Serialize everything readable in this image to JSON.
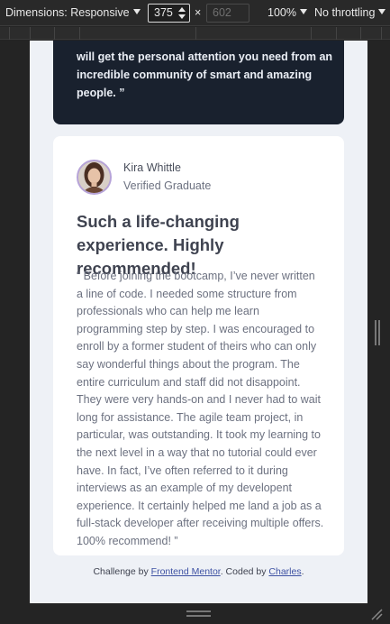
{
  "devtools": {
    "dimensions_label": "Dimensions: Responsive",
    "width_value": "375",
    "height_placeholder": "602",
    "times": "×",
    "zoom": "100%",
    "throttling": "No throttling"
  },
  "page": {
    "previous_card": {
      "text": "will get the personal attention you need from an incredible community of smart and amazing people. ”"
    },
    "testimonial": {
      "name": "Kira Whittle",
      "role": "Verified Graduate",
      "headline": "Such a life-changing experience. Highly recommended!",
      "quote": "“ Before joining the bootcamp, I’ve never written a line of code. I needed some structure from professionals who can help me learn programming step by step. I was encouraged to enroll by a former student of theirs who can only say wonderful things about the program. The entire curriculum and staff did not disappoint. They were very hands-on and I never had to wait long for assistance. The agile team project, in particular, was outstanding. It took my learning to the next level in a way that no tutorial could ever have. In fact, I’ve often referred to it during interviews as an example of my developent experience. It certainly helped me land a job as a full-stack developer after receiving multiple offers. 100% recommend! ”"
    },
    "attribution": {
      "prefix": "Challenge by ",
      "link1": "Frontend Mentor",
      "middle": ". Coded by ",
      "link2": "Charles",
      "suffix": "."
    }
  }
}
